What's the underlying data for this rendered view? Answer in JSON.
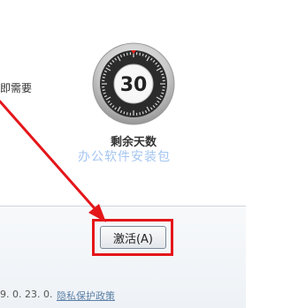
{
  "main": {
    "left_text": "即需要",
    "days_remaining": "30",
    "days_label": "剩余天数",
    "watermark": "办公软件安装包"
  },
  "footer": {
    "activate_label": "激活(A)",
    "version_text": "9. 0. 23. 0.",
    "privacy_link": "隐私保护政策"
  },
  "colors": {
    "highlight": "#e4161a",
    "dial_outer": "#3a3a3a",
    "link": "#5b7fa6"
  }
}
